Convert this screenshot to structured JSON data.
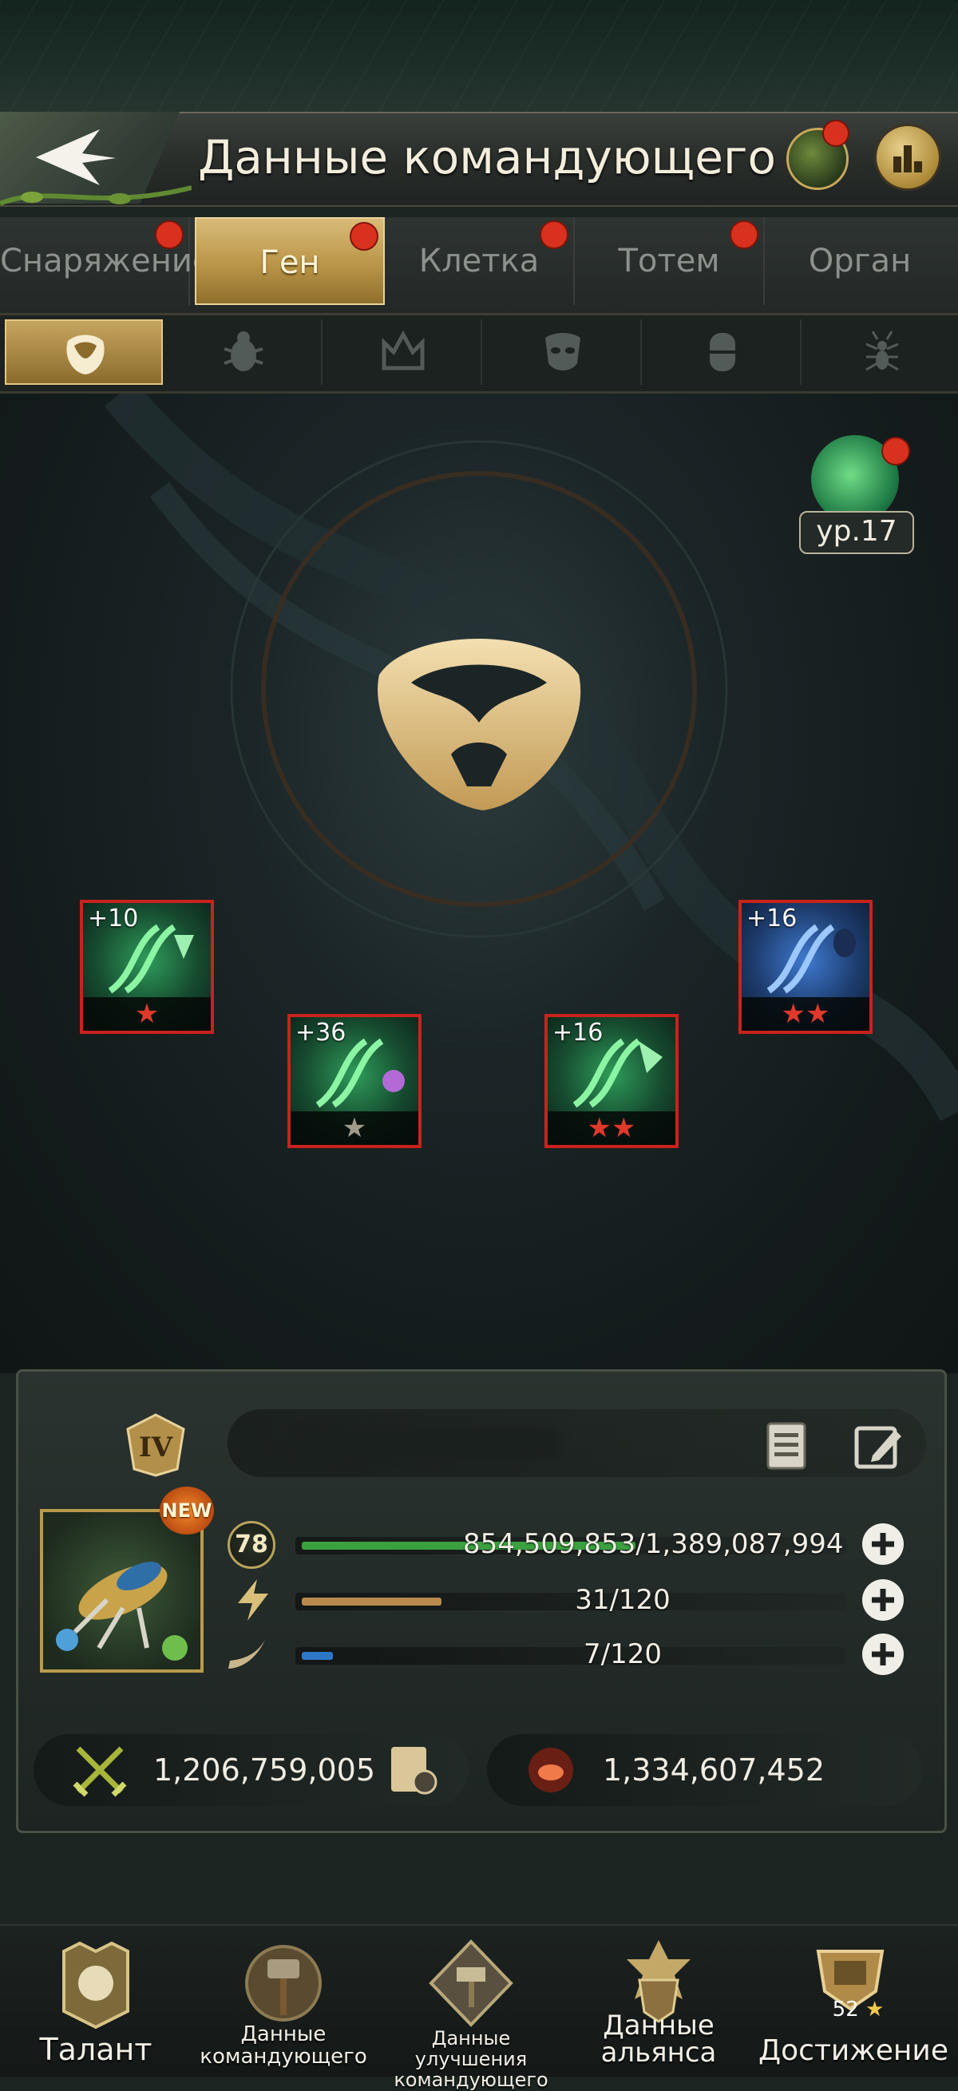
{
  "header": {
    "title": "Данные командующего"
  },
  "tabs": [
    {
      "label": "Снаряжение",
      "active": false,
      "alert": true
    },
    {
      "label": "Ген",
      "active": true,
      "alert": true
    },
    {
      "label": "Клетка",
      "active": false,
      "alert": true
    },
    {
      "label": "Тотем",
      "active": false,
      "alert": true
    },
    {
      "label": "Орган",
      "active": false,
      "alert": false
    }
  ],
  "gene_subtabs": [
    {
      "icon": "skull-emblem-icon",
      "active": true
    },
    {
      "icon": "beetle-icon",
      "active": false
    },
    {
      "icon": "crown-icon",
      "active": false
    },
    {
      "icon": "mask-icon",
      "active": false
    },
    {
      "icon": "capsule-icon",
      "active": false
    },
    {
      "icon": "ant-icon",
      "active": false
    }
  ],
  "gene_level": {
    "label": "ур.17"
  },
  "genes": [
    {
      "level": "+10",
      "stars": "★",
      "star_color": "#e0392b",
      "variant": "green"
    },
    {
      "level": "+36",
      "stars": "★",
      "star_color": "#a09a88",
      "variant": "green"
    },
    {
      "level": "+16",
      "stars": "★★",
      "star_color": "#e0392b",
      "variant": "green"
    },
    {
      "level": "+16",
      "stars": "★★",
      "star_color": "#e0392b",
      "variant": "blue"
    }
  ],
  "commander": {
    "rank": "IV",
    "badge": "NEW",
    "level": "78",
    "stats": [
      {
        "icon": "hp-icon",
        "text": "854,509,853/1,389,087,994",
        "fill": 0.615,
        "color": "#3aa040"
      },
      {
        "icon": "lightning-icon",
        "text": "31/120",
        "fill": 0.258,
        "color": "#b88a4c"
      },
      {
        "icon": "horn-icon",
        "text": "7/120",
        "fill": 0.058,
        "color": "#2e76c8"
      }
    ],
    "power": "1,206,759,005",
    "kills": "1,334,607,452"
  },
  "bottom_nav": [
    {
      "label": "Талант",
      "icon": "talent-crest-icon"
    },
    {
      "label": "Данные командующего",
      "icon": "commander-hammer-icon"
    },
    {
      "label": "Данные улучшения командующего",
      "icon": "upgrade-scroll-icon"
    },
    {
      "label": "Данные альянса",
      "icon": "alliance-shield-icon"
    },
    {
      "label": "Достижение",
      "icon": "trophy-icon",
      "count": "52"
    }
  ],
  "colors": {
    "accent_gold": "#c9a85a",
    "alert_red": "#d9311f",
    "panel_border": "#485146"
  }
}
